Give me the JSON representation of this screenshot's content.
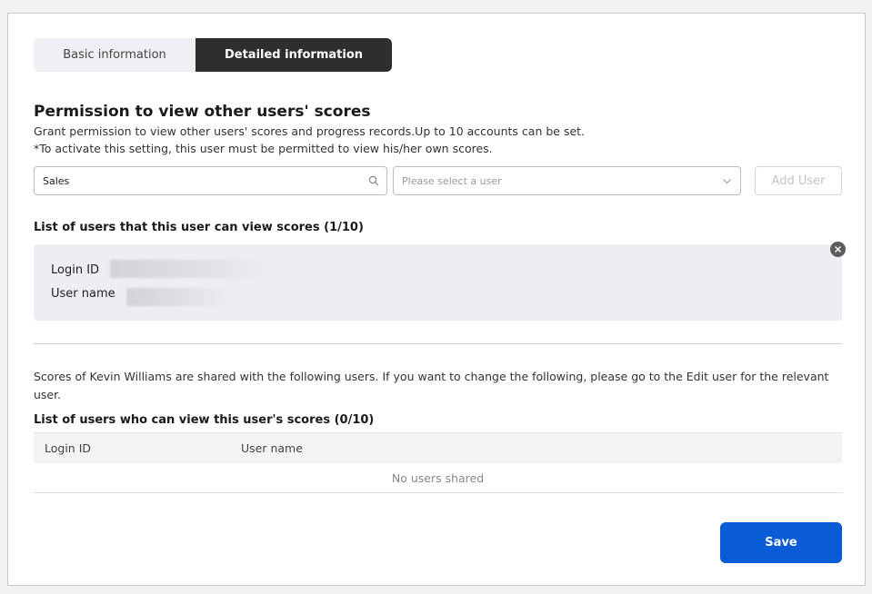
{
  "tabs": [
    {
      "label": "Basic information",
      "active": false
    },
    {
      "label": "Detailed information",
      "active": true
    }
  ],
  "permission": {
    "title": "Permission to view other users' scores",
    "description_line1": "Grant permission to view other users' scores and progress records.Up to 10 accounts can be set.",
    "description_line2": "*To activate this setting, this user must be permitted to view his/her own scores."
  },
  "search": {
    "value": "Sales",
    "icon": "search-icon"
  },
  "user_select": {
    "placeholder": "Please select a user",
    "icon": "chevron-down-icon"
  },
  "add_user_label": "Add User",
  "viewable_list": {
    "title": "List of users that this user can view scores (1/10)",
    "items": [
      {
        "login_id_label": "Login ID",
        "user_name_label": "User name"
      }
    ]
  },
  "shared_note": "Scores of Kevin Williams are shared with the following users. If you want to change the following, please go to the Edit user for the relevant user.",
  "shared_list": {
    "title": "List of users who can view this user's scores (0/10)",
    "columns": [
      "Login ID",
      "User name"
    ],
    "empty_text": "No users shared"
  },
  "save_label": "Save",
  "colors": {
    "primary": "#0a5bd6",
    "active_tab": "#2e2e2e",
    "card_bg": "#ededf2"
  }
}
